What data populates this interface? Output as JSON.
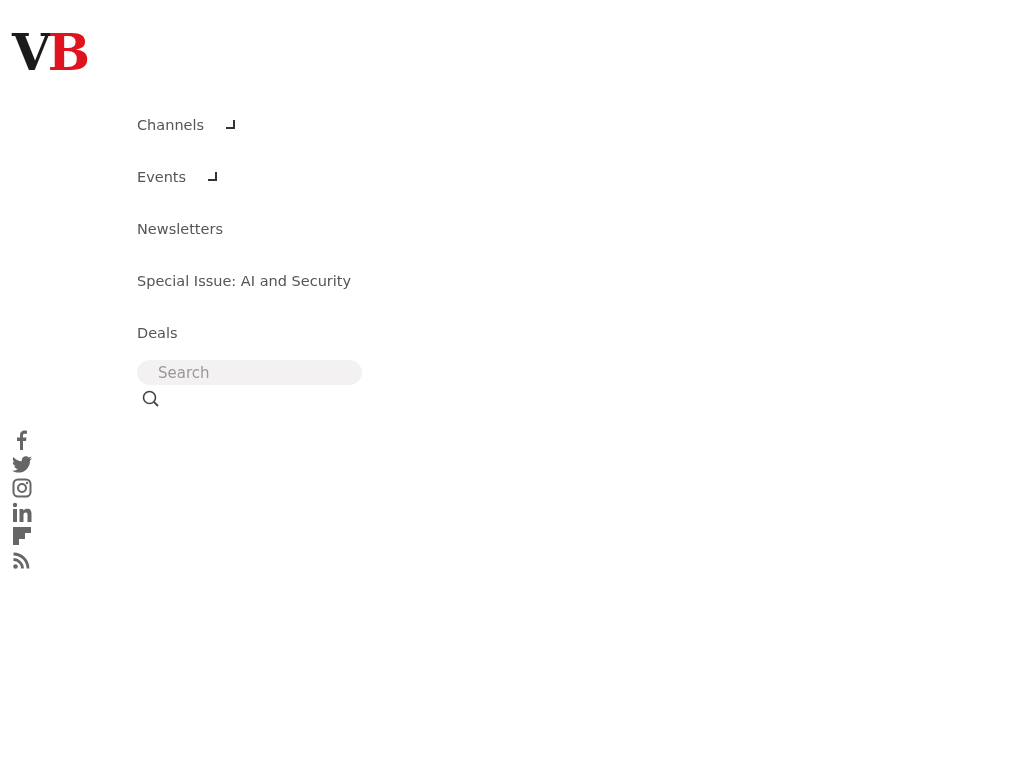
{
  "logo": {
    "first": "V",
    "second": "B"
  },
  "nav": [
    {
      "label": "Channels",
      "has_dropdown": true
    },
    {
      "label": "Events",
      "has_dropdown": true
    },
    {
      "label": "Newsletters",
      "has_dropdown": false
    },
    {
      "label": "Special Issue: AI and Security",
      "has_dropdown": false
    },
    {
      "label": "Deals",
      "has_dropdown": false
    }
  ],
  "search": {
    "placeholder": "Search"
  }
}
